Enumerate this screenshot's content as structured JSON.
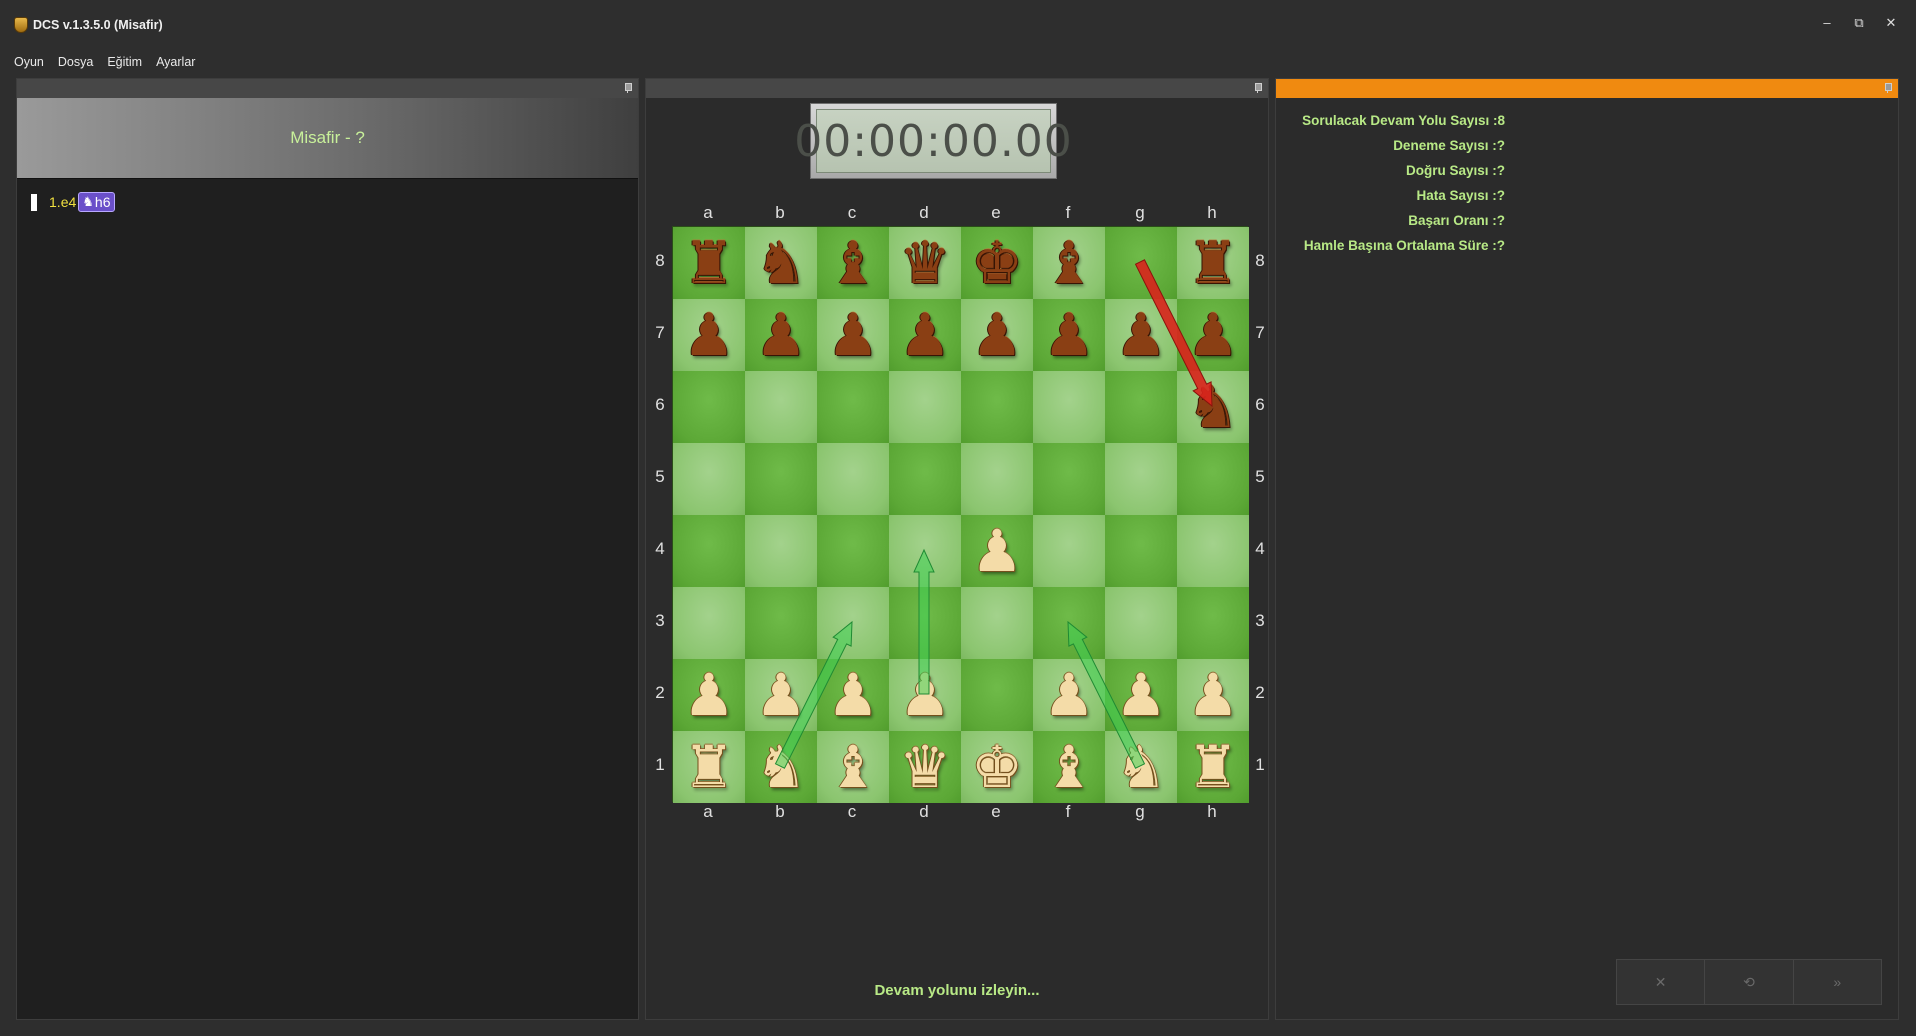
{
  "window": {
    "title": "DCS v.1.3.5.0 (Misafir)",
    "controls": {
      "minimize": "–",
      "restore": "⧉",
      "close": "✕"
    }
  },
  "menu": [
    "Oyun",
    "Dosya",
    "Eğitim",
    "Ayarlar"
  ],
  "left_panel": {
    "player": "Misafir - ?",
    "moves": {
      "number": "1.",
      "white_move": "e4",
      "current_piece": "♞",
      "current_square": "h6"
    }
  },
  "center_panel": {
    "clock": "00:00:00.00",
    "files": [
      "a",
      "b",
      "c",
      "d",
      "e",
      "f",
      "g",
      "h"
    ],
    "ranks": [
      "8",
      "7",
      "6",
      "5",
      "4",
      "3",
      "2",
      "1"
    ],
    "board": [
      [
        "br",
        "bn",
        "bb",
        "bq",
        "bk",
        "bb",
        "",
        "br"
      ],
      [
        "bp",
        "bp",
        "bp",
        "bp",
        "bp",
        "bp",
        "bp",
        "bp"
      ],
      [
        "",
        "",
        "",
        "",
        "",
        "",
        "",
        "bn"
      ],
      [
        "",
        "",
        "",
        "",
        "",
        "",
        "",
        ""
      ],
      [
        "",
        "",
        "",
        "",
        "wp",
        "",
        "",
        ""
      ],
      [
        "",
        "",
        "",
        "",
        "",
        "",
        "",
        ""
      ],
      [
        "wp",
        "wp",
        "wp",
        "wp",
        "",
        "wp",
        "wp",
        "wp"
      ],
      [
        "wr",
        "wn",
        "wb",
        "wq",
        "wk",
        "wb",
        "wn",
        "wr"
      ]
    ],
    "arrows": [
      {
        "from": "g8",
        "to": "h6",
        "color": "#d9241c"
      },
      {
        "from": "b1",
        "to": "c3",
        "color": "#3fd256"
      },
      {
        "from": "d2",
        "to": "d4",
        "color": "#3fd256"
      },
      {
        "from": "g1",
        "to": "f3",
        "color": "#3fd256"
      }
    ],
    "status": "Devam yolunu izleyin..."
  },
  "right_panel": {
    "stats": [
      {
        "label": "Sorulacak Devam Yolu Sayısı",
        "value": "8"
      },
      {
        "label": "Deneme Sayısı",
        "value": "?"
      },
      {
        "label": "Doğru Sayısı",
        "value": "?"
      },
      {
        "label": "Hata Sayısı",
        "value": "?"
      },
      {
        "label": "Başarı Oranı",
        "value": "?"
      },
      {
        "label": "Hamle Başına Ortalama Süre",
        "value": "?"
      }
    ],
    "actions": [
      {
        "name": "close-icon",
        "glyph": "✕"
      },
      {
        "name": "refresh-icon",
        "glyph": "⟲"
      },
      {
        "name": "fast-forward-icon",
        "glyph": "»"
      }
    ]
  }
}
